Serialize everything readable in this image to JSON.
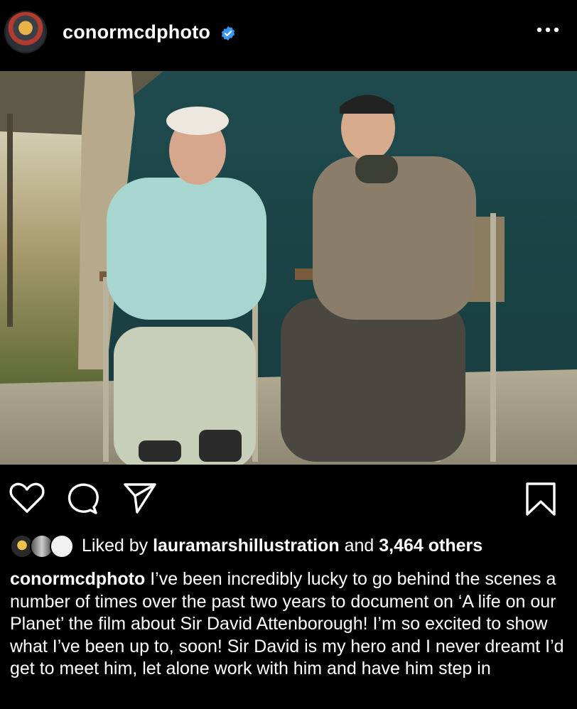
{
  "post": {
    "username": "conormcdphoto",
    "icons": {
      "avatar": "profile-avatar",
      "verified": "verified-badge-icon",
      "more": "more-options-icon",
      "like": "heart-icon",
      "comment": "comment-bubble-icon",
      "share": "paper-plane-icon",
      "save": "bookmark-icon"
    },
    "colors": {
      "verified": "#3897f0",
      "background": "#000000",
      "text": "#ffffff"
    }
  },
  "likes": {
    "prefix": "Liked by ",
    "user": "lauramarshillustration",
    "middle": " and ",
    "count": "3,464 others"
  },
  "caption": {
    "username": "conormcdphoto",
    "text": " I’ve been incredibly lucky to go behind the scenes a number of times over the past two years to document on ‘A life on our Planet’ the film about Sir David Attenborough! I’m so excited to show what I’ve been up to, soon! Sir David is my hero and I never dreamt I’d get to meet him, let alone work with him and have him step in"
  }
}
